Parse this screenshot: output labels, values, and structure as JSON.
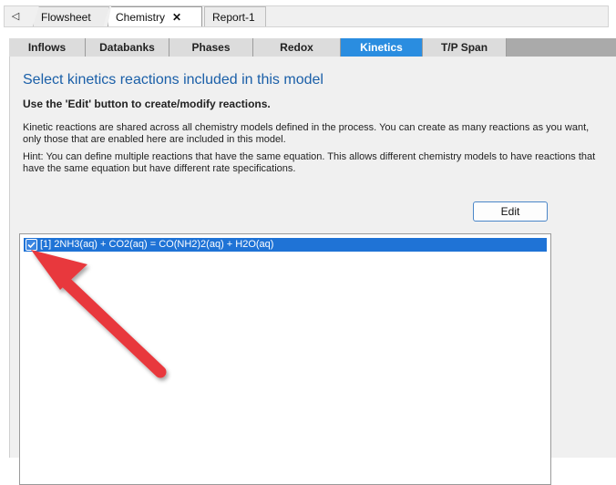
{
  "doc_tabs": {
    "scroll_left": "◁",
    "flowsheet": "Flowsheet",
    "chemistry": "Chemistry",
    "close": "✕",
    "report": "Report-1"
  },
  "form_tabs": [
    {
      "label": "Inflows"
    },
    {
      "label": "Databanks"
    },
    {
      "label": "Phases"
    },
    {
      "label": "Redox"
    },
    {
      "label": "Kinetics"
    },
    {
      "label": "T/P Span"
    }
  ],
  "active_tab": "Kinetics",
  "content": {
    "heading": "Select kinetics reactions included in this model",
    "subheading": "Use the 'Edit' button to create/modify reactions.",
    "para1": "Kinetic reactions are shared across all chemistry models defined in the process. You can create as many reactions as you want, only those that are enabled here are included in this model.",
    "para2": "Hint: You can define multiple reactions that have the same equation. This allows different chemistry models to have reactions that have the same equation but have different rate specifications.",
    "edit_button": "Edit"
  },
  "reactions": [
    {
      "label": "[1] 2NH3(aq) + CO2(aq) = CO(NH2)2(aq) + H2O(aq)",
      "checked": true
    }
  ],
  "colors": {
    "accent": "#2a8de0",
    "selection": "#1f73d6",
    "heading": "#1a5fa8",
    "arrow": "#e8393d"
  }
}
